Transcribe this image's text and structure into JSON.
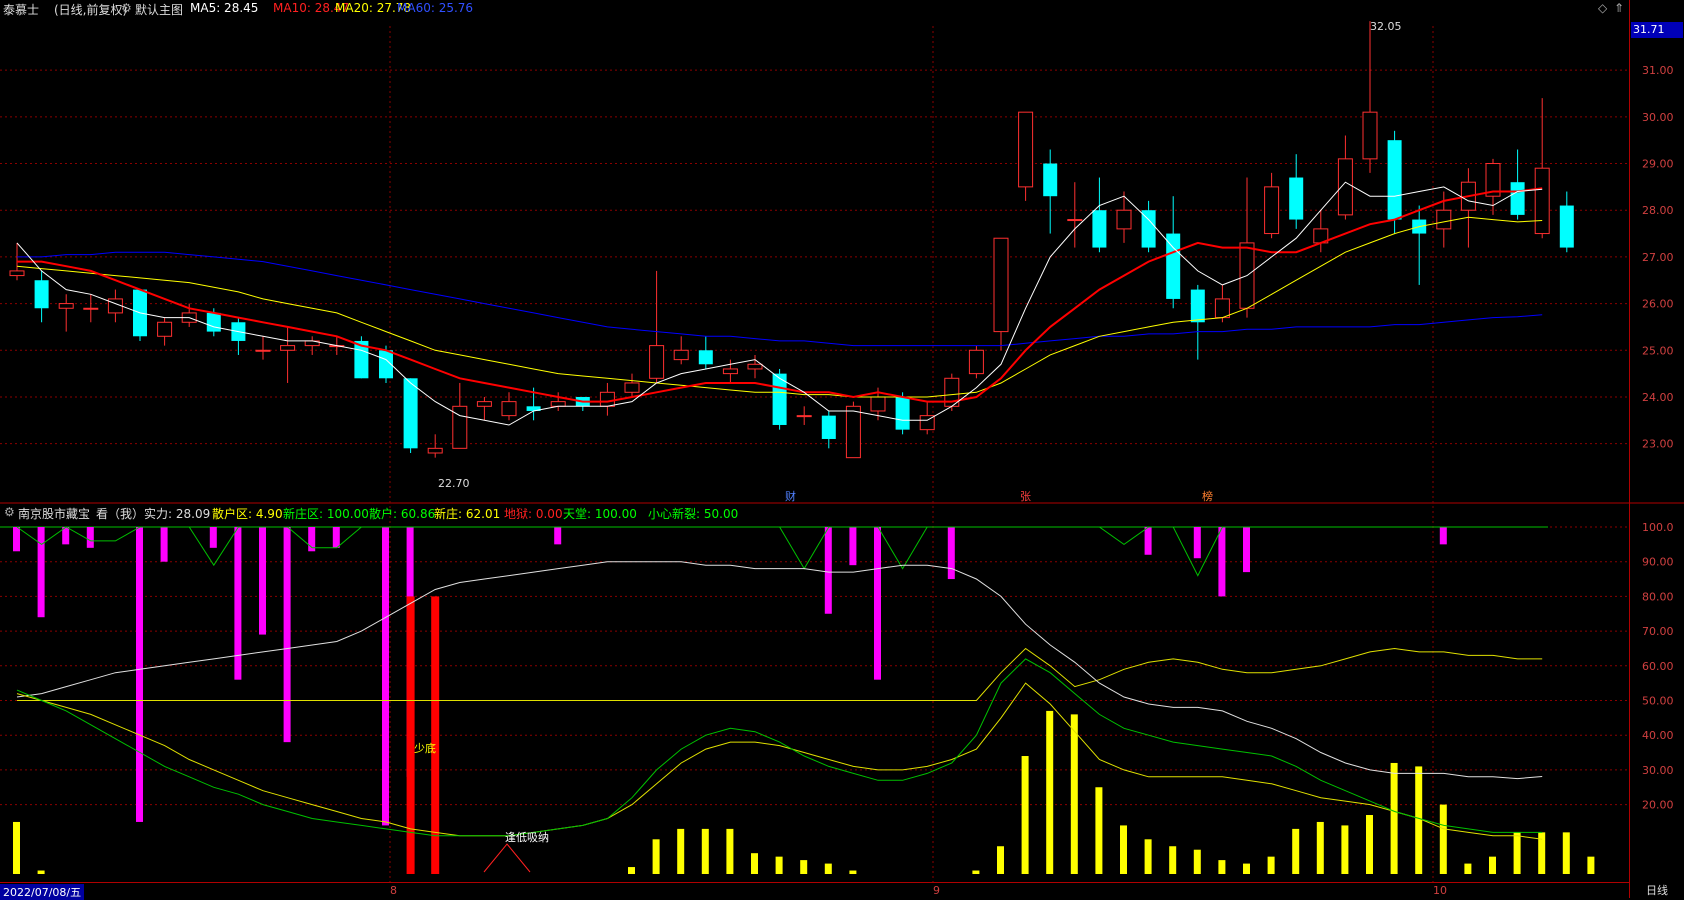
{
  "header": {
    "stock_name": "泰慕士",
    "stock_mode": "(日线,前复权)",
    "main_chart_label": "默认主图",
    "ma5": "MA5: 28.45",
    "ma10": "MA10: 28.47",
    "ma20": "MA20: 27.78",
    "ma60": "MA60: 25.76"
  },
  "indicator": {
    "name": "南京股市藏宝",
    "view": "看（我）",
    "strength": "实力: 28.09",
    "retail_zone": "散户区: 4.90",
    "new_dealer_zone": "新庄区: 100.00",
    "retail": "散户: 60.86",
    "new_dealer": "新庄: 62.01",
    "hell": "地狱: 0.00",
    "heaven": "天堂: 100.00",
    "caution_break": "小心新裂: 50.00",
    "annotation_low": "少底",
    "annotation_absorb": "逢低吸纳"
  },
  "price_axis": {
    "current": "31.71",
    "labels": [
      "31.00",
      "30.00",
      "29.00",
      "28.00",
      "27.00",
      "26.00",
      "25.00",
      "24.00",
      "23.00"
    ]
  },
  "indicator_axis": {
    "labels": [
      "100.0",
      "90.00",
      "80.00",
      "70.00",
      "60.00",
      "50.00",
      "40.00",
      "30.00",
      "20.00"
    ]
  },
  "markers": {
    "high": "32.05",
    "low": "22.70",
    "event_1": "财",
    "event_2": "张",
    "event_3": "榜"
  },
  "time_axis": {
    "start_date": "2022/07/08/五",
    "months": [
      "8",
      "9",
      "10"
    ],
    "period": "日线"
  },
  "colors": {
    "up": "#ff3030",
    "down": "#00ffff",
    "ma5": "#ffffff",
    "ma10": "#ff0000",
    "ma20": "#ffff00",
    "ma60": "#0000ff",
    "grid": "#8b0000"
  },
  "chart_data": {
    "type": "candlestick",
    "ma5_label_value": 28.45,
    "candles": [
      {
        "o": 26.6,
        "c": 26.7,
        "h": 27.3,
        "l": 26.5
      },
      {
        "o": 26.5,
        "c": 25.9,
        "h": 26.7,
        "l": 25.6
      },
      {
        "o": 25.9,
        "c": 26.0,
        "h": 26.2,
        "l": 25.4
      },
      {
        "o": 25.9,
        "c": 25.9,
        "h": 26.2,
        "l": 25.6
      },
      {
        "o": 25.8,
        "c": 26.1,
        "h": 26.3,
        "l": 25.6
      },
      {
        "o": 26.3,
        "c": 25.3,
        "h": 26.3,
        "l": 25.2
      },
      {
        "o": 25.3,
        "c": 25.6,
        "h": 25.7,
        "l": 25.1
      },
      {
        "o": 25.6,
        "c": 25.8,
        "h": 26.0,
        "l": 25.5
      },
      {
        "o": 25.8,
        "c": 25.4,
        "h": 25.9,
        "l": 25.3
      },
      {
        "o": 25.6,
        "c": 25.2,
        "h": 25.7,
        "l": 24.9
      },
      {
        "o": 25.0,
        "c": 25.0,
        "h": 25.3,
        "l": 24.8
      },
      {
        "o": 25.0,
        "c": 25.1,
        "h": 25.5,
        "l": 24.3
      },
      {
        "o": 25.1,
        "c": 25.2,
        "h": 25.3,
        "l": 24.9
      },
      {
        "o": 25.1,
        "c": 25.1,
        "h": 25.3,
        "l": 24.9
      },
      {
        "o": 25.2,
        "c": 24.4,
        "h": 25.3,
        "l": 24.4
      },
      {
        "o": 25.0,
        "c": 24.4,
        "h": 25.1,
        "l": 24.3
      },
      {
        "o": 24.4,
        "c": 22.9,
        "h": 24.4,
        "l": 22.8
      },
      {
        "o": 22.8,
        "c": 22.9,
        "h": 23.2,
        "l": 22.7
      },
      {
        "o": 22.9,
        "c": 23.8,
        "h": 24.3,
        "l": 22.9
      },
      {
        "o": 23.8,
        "c": 23.9,
        "h": 24.0,
        "l": 23.5
      },
      {
        "o": 23.6,
        "c": 23.9,
        "h": 24.1,
        "l": 23.5
      },
      {
        "o": 23.8,
        "c": 23.7,
        "h": 24.2,
        "l": 23.5
      },
      {
        "o": 23.8,
        "c": 23.9,
        "h": 24.1,
        "l": 23.7
      },
      {
        "o": 24.0,
        "c": 23.8,
        "h": 24.0,
        "l": 23.7
      },
      {
        "o": 23.8,
        "c": 24.1,
        "h": 24.3,
        "l": 23.6
      },
      {
        "o": 24.1,
        "c": 24.3,
        "h": 24.5,
        "l": 24.0
      },
      {
        "o": 24.4,
        "c": 25.1,
        "h": 26.7,
        "l": 24.3
      },
      {
        "o": 24.8,
        "c": 25.0,
        "h": 25.3,
        "l": 24.7
      },
      {
        "o": 25.0,
        "c": 24.7,
        "h": 25.3,
        "l": 24.6
      },
      {
        "o": 24.5,
        "c": 24.6,
        "h": 24.8,
        "l": 24.3
      },
      {
        "o": 24.6,
        "c": 24.7,
        "h": 24.9,
        "l": 24.4
      },
      {
        "o": 24.5,
        "c": 23.4,
        "h": 24.6,
        "l": 23.3
      },
      {
        "o": 23.6,
        "c": 23.6,
        "h": 23.8,
        "l": 23.4
      },
      {
        "o": 23.6,
        "c": 23.1,
        "h": 23.7,
        "l": 22.9
      },
      {
        "o": 22.7,
        "c": 23.8,
        "h": 23.9,
        "l": 22.7
      },
      {
        "o": 23.7,
        "c": 24.0,
        "h": 24.2,
        "l": 23.5
      },
      {
        "o": 24.0,
        "c": 23.3,
        "h": 24.1,
        "l": 23.2
      },
      {
        "o": 23.3,
        "c": 23.6,
        "h": 23.9,
        "l": 23.2
      },
      {
        "o": 23.8,
        "c": 24.4,
        "h": 24.5,
        "l": 23.7
      },
      {
        "o": 24.5,
        "c": 25.0,
        "h": 25.1,
        "l": 24.4
      },
      {
        "o": 25.4,
        "c": 27.4,
        "h": 27.4,
        "l": 25.0
      },
      {
        "o": 28.5,
        "c": 30.1,
        "h": 30.1,
        "l": 28.2
      },
      {
        "o": 29.0,
        "c": 28.3,
        "h": 29.3,
        "l": 27.5
      },
      {
        "o": 27.8,
        "c": 27.8,
        "h": 28.6,
        "l": 27.2
      },
      {
        "o": 28.0,
        "c": 27.2,
        "h": 28.7,
        "l": 27.1
      },
      {
        "o": 27.6,
        "c": 28.0,
        "h": 28.4,
        "l": 27.3
      },
      {
        "o": 28.0,
        "c": 27.2,
        "h": 28.2,
        "l": 27.1
      },
      {
        "o": 27.5,
        "c": 26.1,
        "h": 28.3,
        "l": 25.9
      },
      {
        "o": 26.3,
        "c": 25.6,
        "h": 26.4,
        "l": 24.8
      },
      {
        "o": 25.7,
        "c": 26.1,
        "h": 26.4,
        "l": 25.6
      },
      {
        "o": 25.9,
        "c": 27.3,
        "h": 28.7,
        "l": 25.7
      },
      {
        "o": 27.5,
        "c": 28.5,
        "h": 28.8,
        "l": 27.4
      },
      {
        "o": 28.7,
        "c": 27.8,
        "h": 29.2,
        "l": 27.6
      },
      {
        "o": 27.3,
        "c": 27.6,
        "h": 28.0,
        "l": 27.1
      },
      {
        "o": 27.9,
        "c": 29.1,
        "h": 29.6,
        "l": 27.8
      },
      {
        "o": 29.1,
        "c": 30.1,
        "h": 32.05,
        "l": 28.8
      },
      {
        "o": 29.5,
        "c": 27.8,
        "h": 29.7,
        "l": 27.5
      },
      {
        "o": 27.8,
        "c": 27.5,
        "h": 28.1,
        "l": 26.4
      },
      {
        "o": 27.6,
        "c": 28.0,
        "h": 28.4,
        "l": 27.2
      },
      {
        "o": 28.0,
        "c": 28.6,
        "h": 28.9,
        "l": 27.2
      },
      {
        "o": 28.3,
        "c": 29.0,
        "h": 29.1,
        "l": 27.9
      },
      {
        "o": 28.6,
        "c": 27.9,
        "h": 29.3,
        "l": 27.8
      },
      {
        "o": 27.5,
        "c": 28.9,
        "h": 30.4,
        "l": 27.4
      },
      {
        "o": 28.1,
        "c": 27.2,
        "h": 28.4,
        "l": 27.1
      }
    ],
    "ma5": [
      27.3,
      26.7,
      26.3,
      26.2,
      26.0,
      25.8,
      25.7,
      25.7,
      25.5,
      25.4,
      25.3,
      25.2,
      25.2,
      25.1,
      25.0,
      24.8,
      24.3,
      23.9,
      23.6,
      23.5,
      23.4,
      23.7,
      23.8,
      23.8,
      23.8,
      23.9,
      24.3,
      24.5,
      24.6,
      24.7,
      24.8,
      24.4,
      24.1,
      23.7,
      23.7,
      23.6,
      23.5,
      23.5,
      23.8,
      24.2,
      24.7,
      25.9,
      27.0,
      27.6,
      28.1,
      28.3,
      27.8,
      27.2,
      26.7,
      26.4,
      26.6,
      27.0,
      27.4,
      28.0,
      28.6,
      28.3,
      28.3,
      28.4,
      28.5,
      28.2,
      28.1,
      28.4,
      28.45
    ],
    "ma10": [
      26.9,
      26.9,
      26.8,
      26.7,
      26.5,
      26.3,
      26.1,
      25.9,
      25.8,
      25.7,
      25.6,
      25.5,
      25.4,
      25.3,
      25.1,
      25.0,
      24.8,
      24.6,
      24.4,
      24.3,
      24.2,
      24.1,
      24.0,
      23.9,
      23.9,
      24.0,
      24.1,
      24.2,
      24.3,
      24.3,
      24.3,
      24.2,
      24.1,
      24.1,
      24.0,
      24.1,
      24.0,
      23.9,
      23.9,
      24.0,
      24.4,
      25.0,
      25.5,
      25.9,
      26.3,
      26.6,
      26.9,
      27.1,
      27.3,
      27.2,
      27.2,
      27.1,
      27.1,
      27.3,
      27.5,
      27.7,
      27.8,
      28.0,
      28.2,
      28.3,
      28.4,
      28.4,
      28.47
    ],
    "ma20": [
      26.8,
      26.75,
      26.7,
      26.65,
      26.6,
      26.55,
      26.5,
      26.45,
      26.35,
      26.25,
      26.1,
      26.0,
      25.9,
      25.8,
      25.6,
      25.4,
      25.2,
      25.0,
      24.9,
      24.8,
      24.7,
      24.6,
      24.5,
      24.45,
      24.4,
      24.35,
      24.3,
      24.25,
      24.2,
      24.15,
      24.1,
      24.1,
      24.05,
      24.05,
      24.0,
      24.0,
      24.0,
      24.0,
      24.05,
      24.1,
      24.3,
      24.6,
      24.9,
      25.1,
      25.3,
      25.4,
      25.5,
      25.6,
      25.65,
      25.7,
      25.9,
      26.2,
      26.5,
      26.8,
      27.1,
      27.3,
      27.5,
      27.65,
      27.75,
      27.85,
      27.8,
      27.75,
      27.78
    ],
    "ma60": [
      27.0,
      27.0,
      27.05,
      27.05,
      27.1,
      27.1,
      27.1,
      27.05,
      27.0,
      26.95,
      26.9,
      26.8,
      26.7,
      26.6,
      26.5,
      26.4,
      26.3,
      26.2,
      26.1,
      26.0,
      25.9,
      25.8,
      25.7,
      25.6,
      25.5,
      25.45,
      25.4,
      25.35,
      25.3,
      25.3,
      25.25,
      25.2,
      25.2,
      25.15,
      25.1,
      25.1,
      25.1,
      25.1,
      25.1,
      25.1,
      25.1,
      25.15,
      25.2,
      25.25,
      25.3,
      25.3,
      25.35,
      25.35,
      25.4,
      25.4,
      25.45,
      25.45,
      25.5,
      25.5,
      25.5,
      25.5,
      25.55,
      25.55,
      25.6,
      25.65,
      25.7,
      25.72,
      25.76
    ],
    "indicator": {
      "ylim": [
        0,
        100
      ],
      "white_line": [
        51,
        52,
        54,
        56,
        58,
        59,
        60,
        61,
        62,
        63,
        64,
        65,
        66,
        67,
        70,
        74,
        78,
        82,
        84,
        85,
        86,
        87,
        88,
        89,
        90,
        90,
        90,
        90,
        89,
        89,
        88,
        88,
        88,
        87,
        87,
        88,
        89,
        89,
        88,
        85,
        80,
        72,
        66,
        61,
        55,
        51,
        49,
        48,
        48,
        47,
        44,
        42,
        39,
        35,
        32,
        30,
        29,
        29,
        29,
        28,
        28,
        27.5,
        28.09
      ],
      "yellow_line": [
        52,
        50,
        48,
        46,
        43,
        40,
        37,
        33,
        30,
        27,
        24,
        22,
        20,
        18,
        16,
        15,
        13,
        12,
        11,
        11,
        11,
        12,
        13,
        14,
        16,
        20,
        26,
        32,
        36,
        38,
        38,
        37,
        35,
        33,
        31,
        30,
        30,
        31,
        33,
        36,
        45,
        55,
        49,
        41,
        33,
        30,
        28,
        28,
        28,
        28,
        27,
        26,
        24,
        22,
        21,
        20,
        18,
        16,
        13,
        12,
        11,
        11,
        10
      ],
      "green_line": [
        53,
        50,
        47,
        43,
        39,
        35,
        31,
        28,
        25,
        23,
        20,
        18,
        16,
        15,
        14,
        13,
        12,
        11,
        11,
        11,
        11,
        12,
        13,
        14,
        16,
        22,
        30,
        36,
        40,
        42,
        41,
        38,
        34,
        31,
        29,
        27,
        27,
        29,
        32,
        40,
        55,
        62,
        58,
        52,
        46,
        42,
        40,
        38,
        37,
        36,
        35,
        34,
        31,
        27,
        24,
        21,
        18,
        16,
        14,
        13,
        12,
        12,
        12
      ],
      "green_upper": [
        100,
        95,
        100,
        96,
        96,
        100,
        100,
        100,
        89,
        100,
        100,
        100,
        94,
        94,
        100,
        100,
        100,
        100,
        100,
        100,
        100,
        100,
        100,
        100,
        100,
        100,
        100,
        100,
        100,
        100,
        100,
        100,
        88,
        100,
        100,
        100,
        88,
        100,
        100,
        100,
        100,
        100,
        100,
        100,
        100,
        95,
        100,
        100,
        86,
        100,
        100,
        100,
        100,
        100,
        100,
        100,
        100,
        100,
        100,
        100,
        100,
        100,
        100
      ],
      "yellow_flat": [
        50,
        50,
        50,
        50,
        50,
        50,
        50,
        50,
        50,
        50,
        50,
        50,
        50,
        50,
        50,
        50,
        50,
        50,
        50,
        50,
        50,
        50,
        50,
        50,
        50,
        50,
        50,
        50,
        50,
        50,
        50,
        50,
        50,
        50,
        50,
        50,
        50,
        50,
        50,
        50,
        58,
        65,
        60,
        54,
        56,
        59,
        61,
        62,
        61,
        59,
        58,
        58,
        59,
        60,
        62,
        64,
        65,
        64,
        64,
        63,
        63,
        62,
        62
      ],
      "magenta_bars": [
        {
          "i": 0,
          "v": 93
        },
        {
          "i": 1,
          "v": 74
        },
        {
          "i": 2,
          "v": 95
        },
        {
          "i": 3,
          "v": 94
        },
        {
          "i": 5,
          "v": 15
        },
        {
          "i": 6,
          "v": 90
        },
        {
          "i": 8,
          "v": 94
        },
        {
          "i": 9,
          "v": 56
        },
        {
          "i": 10,
          "v": 69
        },
        {
          "i": 11,
          "v": 38
        },
        {
          "i": 12,
          "v": 93
        },
        {
          "i": 13,
          "v": 94
        },
        {
          "i": 15,
          "v": 14
        },
        {
          "i": 16,
          "v": 28
        },
        {
          "i": 22,
          "v": 95
        },
        {
          "i": 33,
          "v": 75
        },
        {
          "i": 34,
          "v": 89
        },
        {
          "i": 35,
          "v": 56
        },
        {
          "i": 38,
          "v": 85
        },
        {
          "i": 46,
          "v": 92
        },
        {
          "i": 48,
          "v": 91
        },
        {
          "i": 49,
          "v": 80
        },
        {
          "i": 50,
          "v": 87
        },
        {
          "i": 58,
          "v": 95
        }
      ],
      "red_bars": [
        {
          "i": 16,
          "v": 80
        },
        {
          "i": 17,
          "v": 80
        }
      ],
      "yellow_bars": [
        15,
        1,
        0,
        0,
        0,
        0,
        0,
        0,
        0,
        0,
        0,
        0,
        0,
        0,
        0,
        0,
        0,
        0,
        0,
        0,
        0,
        0,
        0,
        0,
        0,
        2,
        10,
        13,
        13,
        13,
        6,
        5,
        4,
        3,
        1,
        0,
        0,
        0,
        0,
        1,
        8,
        34,
        47,
        46,
        25,
        14,
        10,
        8,
        7,
        4,
        3,
        5,
        13,
        15,
        14,
        17,
        32,
        31,
        20,
        3,
        5,
        12,
        12,
        12,
        5
      ]
    }
  }
}
